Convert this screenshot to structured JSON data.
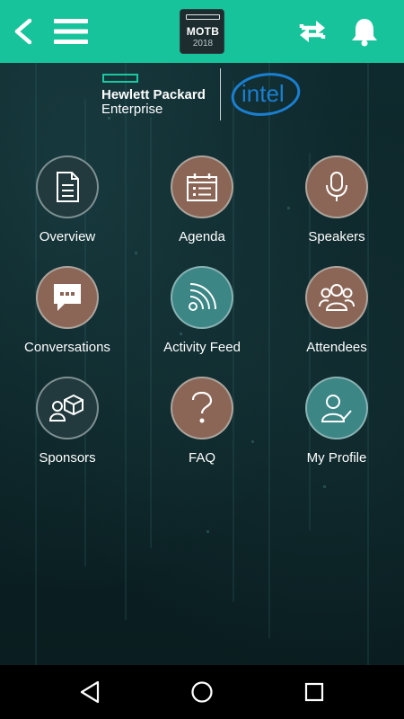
{
  "header": {
    "logo": {
      "title": "MOTB",
      "year": "2018"
    },
    "icons": {
      "back": "back-arrow-icon",
      "menu": "hamburger-menu-icon",
      "sync": "sync-icon",
      "notifications": "bell-icon"
    },
    "accent_color": "#17c39a"
  },
  "sponsors": {
    "hpe": {
      "line1": "Hewlett Packard",
      "line2": "Enterprise"
    },
    "intel": {
      "text": "intel"
    }
  },
  "tiles": [
    {
      "label": "Overview",
      "icon": "document-icon",
      "color": "#22393d"
    },
    {
      "label": "Agenda",
      "icon": "calendar-icon",
      "color": "#8b6656"
    },
    {
      "label": "Speakers",
      "icon": "microphone-icon",
      "color": "#8b6656"
    },
    {
      "label": "Conversations",
      "icon": "chat-bubble-icon",
      "color": "#8b6656"
    },
    {
      "label": "Activity Feed",
      "icon": "rss-feed-icon",
      "color": "#3c8686"
    },
    {
      "label": "Attendees",
      "icon": "people-group-icon",
      "color": "#8b6656"
    },
    {
      "label": "Sponsors",
      "icon": "sponsor-box-icon",
      "color": "#22393d"
    },
    {
      "label": "FAQ",
      "icon": "question-mark-icon",
      "color": "#8b6656"
    },
    {
      "label": "My Profile",
      "icon": "profile-check-icon",
      "color": "#3c8686"
    }
  ],
  "navbar": {
    "back": "nav-back-icon",
    "home": "nav-home-icon",
    "recent": "nav-recent-apps-icon"
  }
}
